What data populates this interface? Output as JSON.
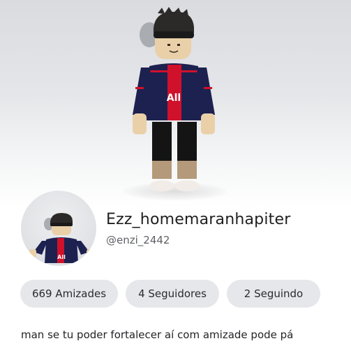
{
  "profile": {
    "display_name": "Ezz_homemaranhapiter",
    "username": "@enzi_2442",
    "bio": "man se tu poder fortalecer aí com amizade pode pá"
  },
  "stats": {
    "friends": "669 Amizades",
    "followers": "4 Seguidores",
    "following": "2 Seguindo"
  },
  "avatar": {
    "shirt_text": "All",
    "shirt_color": "#1c2150",
    "stripe_color": "#d0112b"
  }
}
